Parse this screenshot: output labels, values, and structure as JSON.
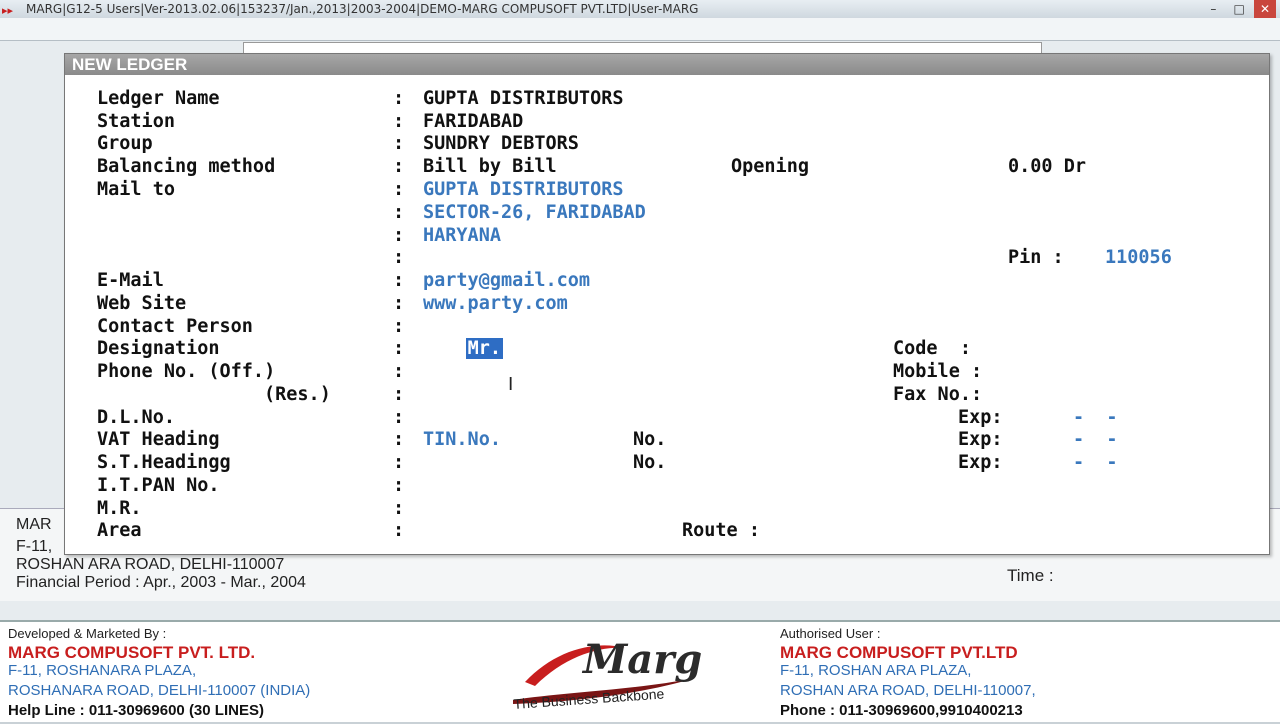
{
  "window": {
    "title": "MARG|G12-5 Users|Ver-2013.02.06|153237/Jan.,2013|2003-2004|DEMO-MARG COMPUSOFT PVT.LTD|User-MARG"
  },
  "background": {
    "line1": "MAR",
    "line2": "F-11,",
    "line3": "ROSHAN ARA ROAD, DELHI-110007",
    "period": "Financial Period : Apr., 2003 - Mar., 2004",
    "time_label": "Time :"
  },
  "dialog": {
    "title": "NEW LEDGER",
    "colon": ":",
    "labels": {
      "ledger_name": "Ledger Name",
      "station": "Station",
      "group": "Group",
      "balancing": "Balancing method",
      "mail_to": "Mail to",
      "email": "E-Mail",
      "website": "Web Site",
      "contact": "Contact Person",
      "designation": "Designation",
      "phone_off": "Phone No. (Off.)",
      "phone_res": "(Res.)",
      "dl_no": "D.L.No.",
      "vat_heading": "VAT Heading",
      "st_heading": "S.T.Headingg",
      "it_pan": "I.T.PAN No.",
      "mr": "M.R.",
      "area": "Area",
      "opening": "Opening",
      "pin": "Pin :",
      "code": "Code  :",
      "mobile": "Mobile :",
      "fax": "Fax No.:",
      "exp": "Exp:",
      "no": "No.",
      "route": "Route :"
    },
    "values": {
      "ledger_name": "GUPTA DISTRIBUTORS",
      "station": "FARIDABAD",
      "group": "SUNDRY DEBTORS",
      "balancing": "Bill by Bill",
      "opening": "0.00 Dr",
      "mail_line1": "GUPTA DISTRIBUTORS",
      "mail_line2": "SECTOR-26, FARIDABAD",
      "mail_line3": "HARYANA",
      "pin": "110056",
      "email": "party@gmail.com",
      "website": "www.party.com",
      "contact": "Mr.",
      "vat_tin": "TIN.No.",
      "exp_dash": "-  -"
    }
  },
  "footer": {
    "dev_label": "Developed & Marketed By :",
    "dev_company": "MARG COMPUSOFT PVT. LTD.",
    "dev_addr1": "F-11, ROSHANARA PLAZA,",
    "dev_addr2": "ROSHANARA ROAD, DELHI-110007 (INDIA)",
    "dev_help": "Help Line : 011-30969600 (30 LINES)",
    "logo_text": "Marg",
    "logo_tagline": "The Business Backbone",
    "auth_label": "Authorised User :",
    "auth_company": "MARG COMPUSOFT PVT.LTD",
    "auth_addr1": "F-11, ROSHAN ARA PLAZA,",
    "auth_addr2": " ROSHAN ARA ROAD, DELHI-110007,",
    "auth_phone": "Phone : 011-30969600,9910400213"
  },
  "colors": {
    "accent_blue": "#3a78bd",
    "brand_red": "#c81e1e",
    "selection": "#2e6dc4"
  }
}
